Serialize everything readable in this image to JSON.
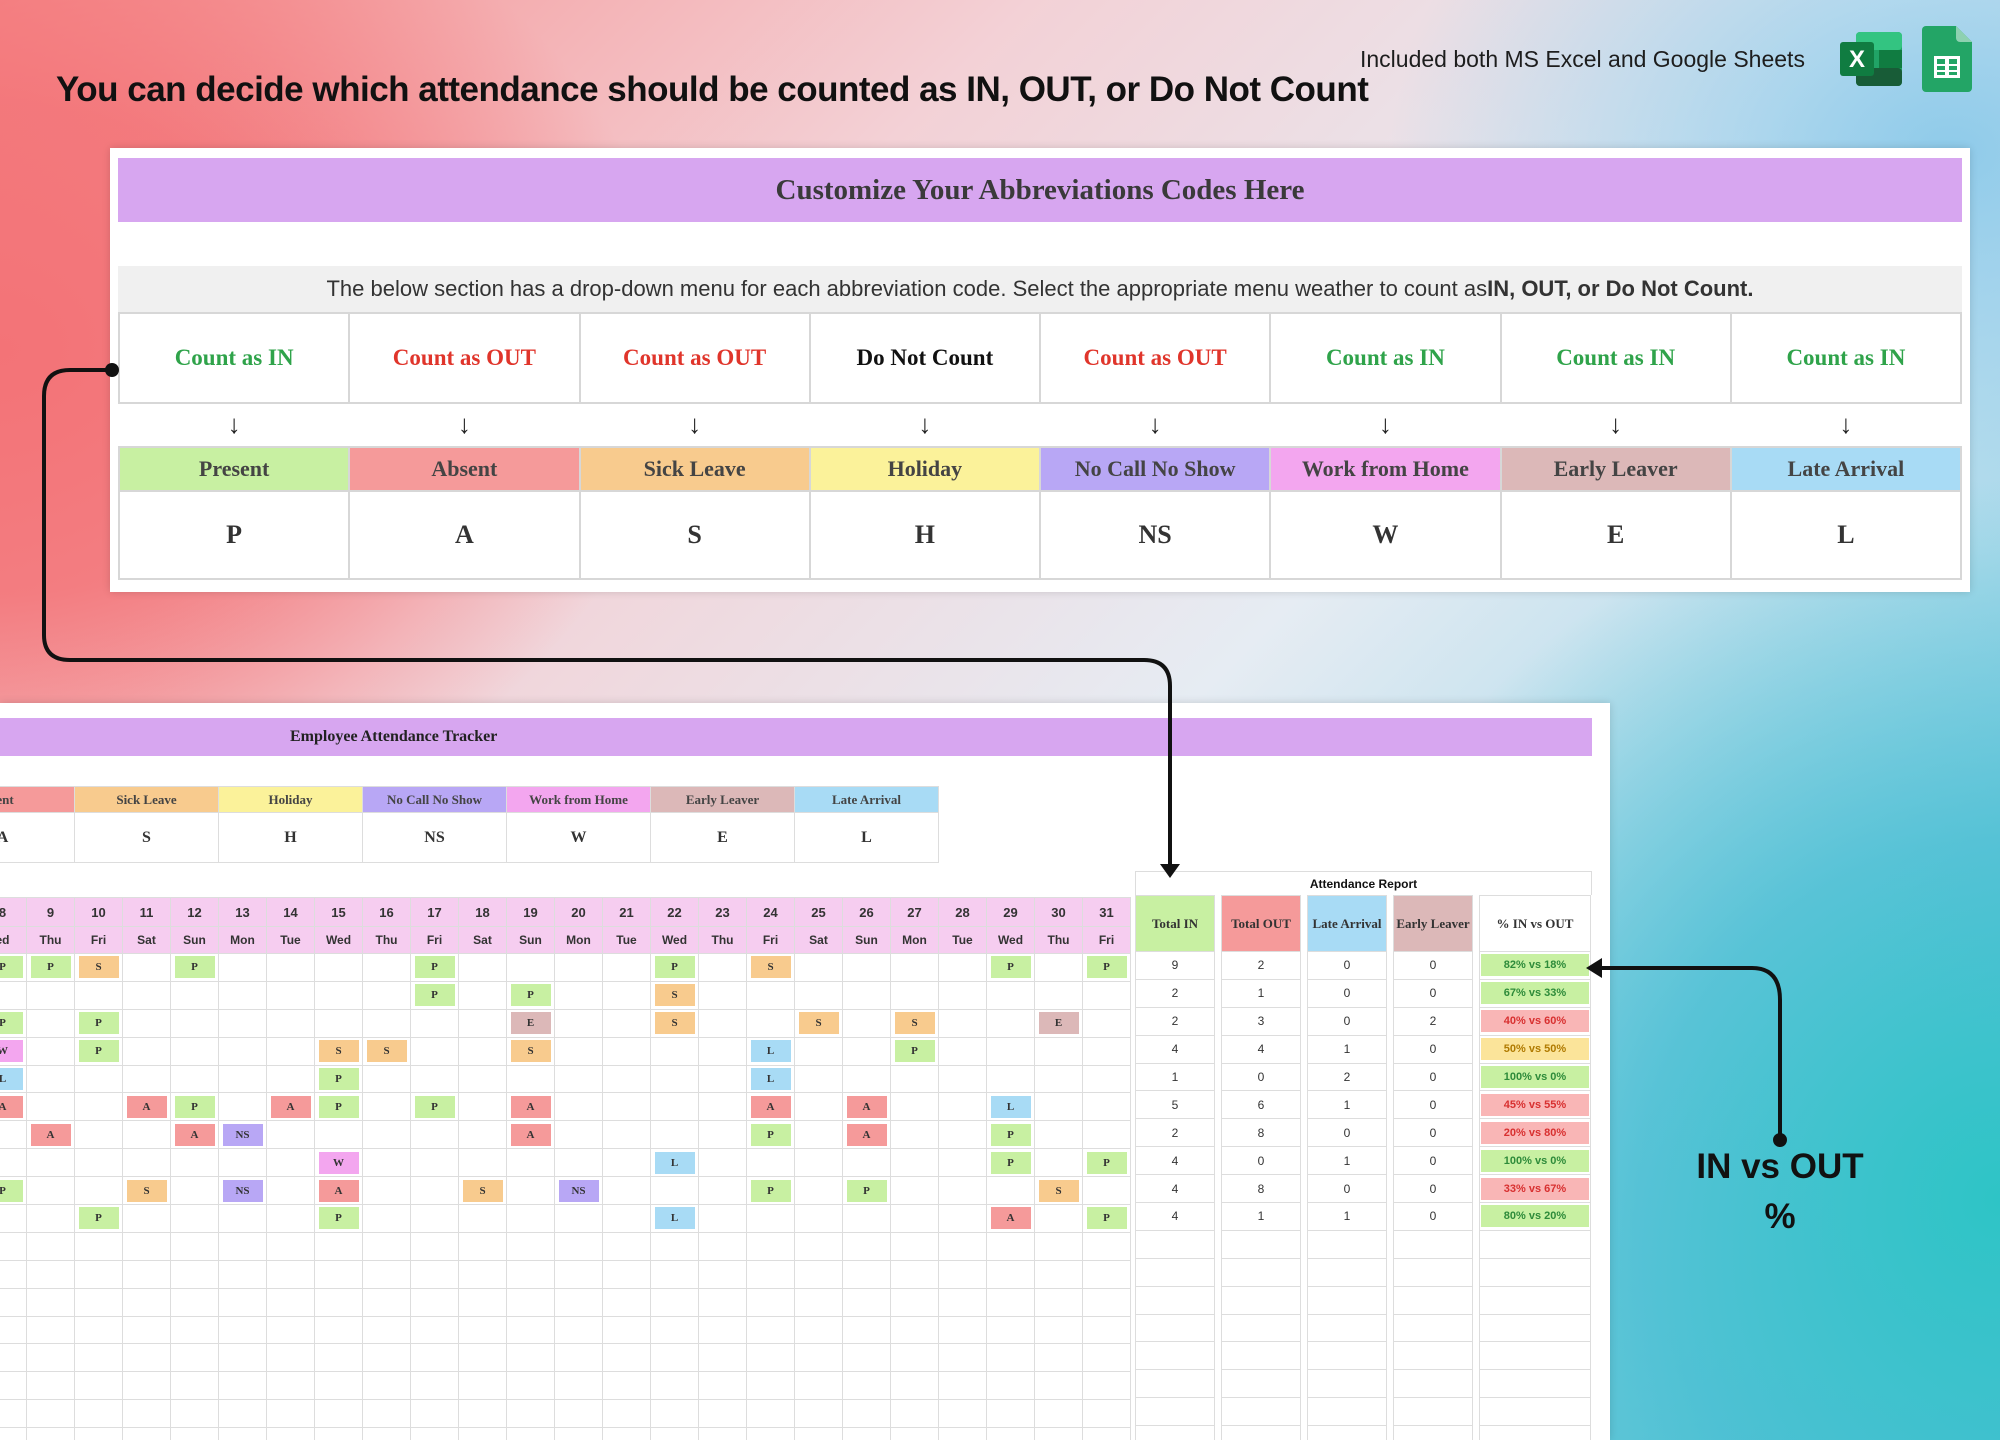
{
  "header": {
    "title": "You can decide which attendance should be counted as IN, OUT, or Do Not Count",
    "included": "Included both MS Excel and Google Sheets",
    "excel_letter": "X"
  },
  "panel": {
    "title": "Customize Your Abbreviations Codes Here",
    "note_prefix": "The below section has a drop-down menu for each abbreviation code. Select the appropriate menu weather to count as ",
    "note_bold": "IN, OUT, or Do Not Count.",
    "arrow": "↓",
    "codes": [
      {
        "count": "Count as IN",
        "kind": "in",
        "name": "Present",
        "color": "#c8f0a2",
        "letter": "P"
      },
      {
        "count": "Count as OUT",
        "kind": "out",
        "name": "Absent",
        "color": "#f59a9a",
        "letter": "A"
      },
      {
        "count": "Count as OUT",
        "kind": "out",
        "name": "Sick Leave",
        "color": "#f8cb8e",
        "letter": "S"
      },
      {
        "count": "Do Not Count",
        "kind": "dnc",
        "name": "Holiday",
        "color": "#fbf29a",
        "letter": "H"
      },
      {
        "count": "Count as OUT",
        "kind": "out",
        "name": "No Call No Show",
        "color": "#b8a7f5",
        "letter": "NS"
      },
      {
        "count": "Count as IN",
        "kind": "in",
        "name": "Work from Home",
        "color": "#f3a6ef",
        "letter": "W"
      },
      {
        "count": "Count as IN",
        "kind": "in",
        "name": "Early Leaver",
        "color": "#dcb8b8",
        "letter": "E"
      },
      {
        "count": "Count as IN",
        "kind": "in",
        "name": "Late Arrival",
        "color": "#a8dbf5",
        "letter": "L"
      }
    ]
  },
  "sheet": {
    "title": "Employee Attendance Tracker",
    "legend": [
      {
        "name": "sent",
        "letter": "A",
        "color": "#f59a9a"
      },
      {
        "name": "Sick Leave",
        "letter": "S",
        "color": "#f8cb8e"
      },
      {
        "name": "Holiday",
        "letter": "H",
        "color": "#fbf29a"
      },
      {
        "name": "No Call No Show",
        "letter": "NS",
        "color": "#b8a7f5"
      },
      {
        "name": "Work from Home",
        "letter": "W",
        "color": "#f3a6ef"
      },
      {
        "name": "Early Leaver",
        "letter": "E",
        "color": "#dcb8b8"
      },
      {
        "name": "Late Arrival",
        "letter": "L",
        "color": "#a8dbf5"
      }
    ],
    "day_numbers": [
      "8",
      "9",
      "10",
      "11",
      "12",
      "13",
      "14",
      "15",
      "16",
      "17",
      "18",
      "19",
      "20",
      "21",
      "22",
      "23",
      "24",
      "25",
      "26",
      "27",
      "28",
      "29",
      "30",
      "31"
    ],
    "day_names": [
      "ed",
      "Thu",
      "Fri",
      "Sat",
      "Sun",
      "Mon",
      "Tue",
      "Wed",
      "Thu",
      "Fri",
      "Sat",
      "Sun",
      "Mon",
      "Tue",
      "Wed",
      "Thu",
      "Fri",
      "Sat",
      "Sun",
      "Mon",
      "Tue",
      "Wed",
      "Thu",
      "Fri"
    ],
    "rows": [
      [
        "P",
        "P",
        "S",
        "",
        "P",
        "",
        "",
        "",
        "",
        "P",
        "",
        "",
        "",
        "",
        "P",
        "",
        "S",
        "",
        "",
        "",
        "",
        "P",
        "",
        "P"
      ],
      [
        "",
        "",
        "",
        "",
        "",
        "",
        "",
        "",
        "",
        "P",
        "",
        "P",
        "",
        "",
        "S",
        "",
        "",
        "",
        "",
        "",
        "",
        "",
        "",
        ""
      ],
      [
        "P",
        "",
        "P",
        "",
        "",
        "",
        "",
        "",
        "",
        "",
        "",
        "E",
        "",
        "",
        "S",
        "",
        "",
        "S",
        "",
        "S",
        "",
        "",
        "E",
        ""
      ],
      [
        "W",
        "",
        "P",
        "",
        "",
        "",
        "",
        "S",
        "S",
        "",
        "",
        "S",
        "",
        "",
        "",
        "",
        "L",
        "",
        "",
        "P",
        "",
        "",
        "",
        ""
      ],
      [
        "L",
        "",
        "",
        "",
        "",
        "",
        "",
        "P",
        "",
        "",
        "",
        "",
        "",
        "",
        "",
        "",
        "L",
        "",
        "",
        "",
        "",
        "",
        "",
        ""
      ],
      [
        "A",
        "",
        "",
        "A",
        "P",
        "",
        "A",
        "P",
        "",
        "P",
        "",
        "A",
        "",
        "",
        "",
        "",
        "A",
        "",
        "A",
        "",
        "",
        "L",
        "",
        ""
      ],
      [
        "",
        "A",
        "",
        "",
        "A",
        "NS",
        "",
        "",
        "",
        "",
        "",
        "A",
        "",
        "",
        "",
        "",
        "P",
        "",
        "A",
        "",
        "",
        "P",
        "",
        ""
      ],
      [
        "",
        "",
        "",
        "",
        "",
        "",
        "",
        "W",
        "",
        "",
        "",
        "",
        "",
        "",
        "L",
        "",
        "",
        "",
        "",
        "",
        "",
        "P",
        "",
        "P"
      ],
      [
        "P",
        "",
        "",
        "S",
        "",
        "NS",
        "",
        "A",
        "",
        "",
        "S",
        "",
        "NS",
        "",
        "",
        "",
        "P",
        "",
        "P",
        "",
        "",
        "",
        "S",
        ""
      ],
      [
        "",
        "",
        "P",
        "",
        "",
        "",
        "",
        "P",
        "",
        "",
        "",
        "",
        "",
        "",
        "L",
        "",
        "",
        "",
        "",
        "",
        "",
        "A",
        "",
        "P"
      ],
      [
        "",
        "",
        "",
        "",
        "",
        "",
        "",
        "",
        "",
        "",
        "",
        "",
        "",
        "",
        "",
        "",
        "",
        "",
        "",
        "",
        "",
        "",
        "",
        ""
      ],
      [
        "",
        "",
        "",
        "",
        "",
        "",
        "",
        "",
        "",
        "",
        "",
        "",
        "",
        "",
        "",
        "",
        "",
        "",
        "",
        "",
        "",
        "",
        "",
        ""
      ],
      [
        "",
        "",
        "",
        "",
        "",
        "",
        "",
        "",
        "",
        "",
        "",
        "",
        "",
        "",
        "",
        "",
        "",
        "",
        "",
        "",
        "",
        "",
        "",
        ""
      ],
      [
        "",
        "",
        "",
        "",
        "",
        "",
        "",
        "",
        "",
        "",
        "",
        "",
        "",
        "",
        "",
        "",
        "",
        "",
        "",
        "",
        "",
        "",
        "",
        ""
      ],
      [
        "",
        "",
        "",
        "",
        "",
        "",
        "",
        "",
        "",
        "",
        "",
        "",
        "",
        "",
        "",
        "",
        "",
        "",
        "",
        "",
        "",
        "",
        "",
        ""
      ],
      [
        "",
        "",
        "",
        "",
        "",
        "",
        "",
        "",
        "",
        "",
        "",
        "",
        "",
        "",
        "",
        "",
        "",
        "",
        "",
        "",
        "",
        "",
        "",
        ""
      ],
      [
        "",
        "",
        "",
        "",
        "",
        "",
        "",
        "",
        "",
        "",
        "",
        "",
        "",
        "",
        "",
        "",
        "",
        "",
        "",
        "",
        "",
        "",
        "",
        ""
      ],
      [
        "",
        "",
        "",
        "",
        "",
        "",
        "",
        "",
        "",
        "",
        "",
        "",
        "",
        "",
        "",
        "",
        "",
        "",
        "",
        "",
        "",
        "",
        "",
        ""
      ]
    ],
    "report": {
      "title": "Attendance Report",
      "headers": [
        "Total IN",
        "Total OUT",
        "Late Arrival",
        "Early Leaver",
        "% IN vs OUT"
      ],
      "header_colors": [
        "#c8f0a2",
        "#f59a9a",
        "#a8dbf5",
        "#dcb8b8",
        "#ffffff"
      ],
      "rows": [
        [
          "9",
          "2",
          "0",
          "0",
          "82% vs 18%"
        ],
        [
          "2",
          "1",
          "0",
          "0",
          "67% vs 33%"
        ],
        [
          "2",
          "3",
          "0",
          "2",
          "40% vs 60%"
        ],
        [
          "4",
          "4",
          "1",
          "0",
          "50% vs 50%"
        ],
        [
          "1",
          "0",
          "2",
          "0",
          "100% vs 0%"
        ],
        [
          "5",
          "6",
          "1",
          "0",
          "45% vs 55%"
        ],
        [
          "2",
          "8",
          "0",
          "0",
          "20% vs 80%"
        ],
        [
          "4",
          "0",
          "1",
          "0",
          "100% vs 0%"
        ],
        [
          "4",
          "8",
          "0",
          "0",
          "33% vs 67%"
        ],
        [
          "4",
          "1",
          "1",
          "0",
          "80% vs 20%"
        ]
      ],
      "pct_styles": [
        {
          "bg": "#c8f0a2",
          "fg": "#2e8b3a"
        },
        {
          "bg": "#c8f0a2",
          "fg": "#2e8b3a"
        },
        {
          "bg": "#f9b6b6",
          "fg": "#d83030"
        },
        {
          "bg": "#fbe49a",
          "fg": "#b07a00"
        },
        {
          "bg": "#c8f0a2",
          "fg": "#2e8b3a"
        },
        {
          "bg": "#f9b6b6",
          "fg": "#d83030"
        },
        {
          "bg": "#f9b6b6",
          "fg": "#d83030"
        },
        {
          "bg": "#c8f0a2",
          "fg": "#2e8b3a"
        },
        {
          "bg": "#f9b6b6",
          "fg": "#d83030"
        },
        {
          "bg": "#c8f0a2",
          "fg": "#2e8b3a"
        }
      ]
    }
  },
  "callout": {
    "line1": "IN vs OUT",
    "line2": "%"
  },
  "colors": {
    "P": "#c8f0a2",
    "A": "#f59a9a",
    "S": "#f8cb8e",
    "H": "#fbf29a",
    "NS": "#b8a7f5",
    "W": "#f3a6ef",
    "E": "#dcb8b8",
    "L": "#a8dbf5",
    "in": "#2fa34a",
    "out": "#e0352b",
    "dnc": "#111111"
  }
}
